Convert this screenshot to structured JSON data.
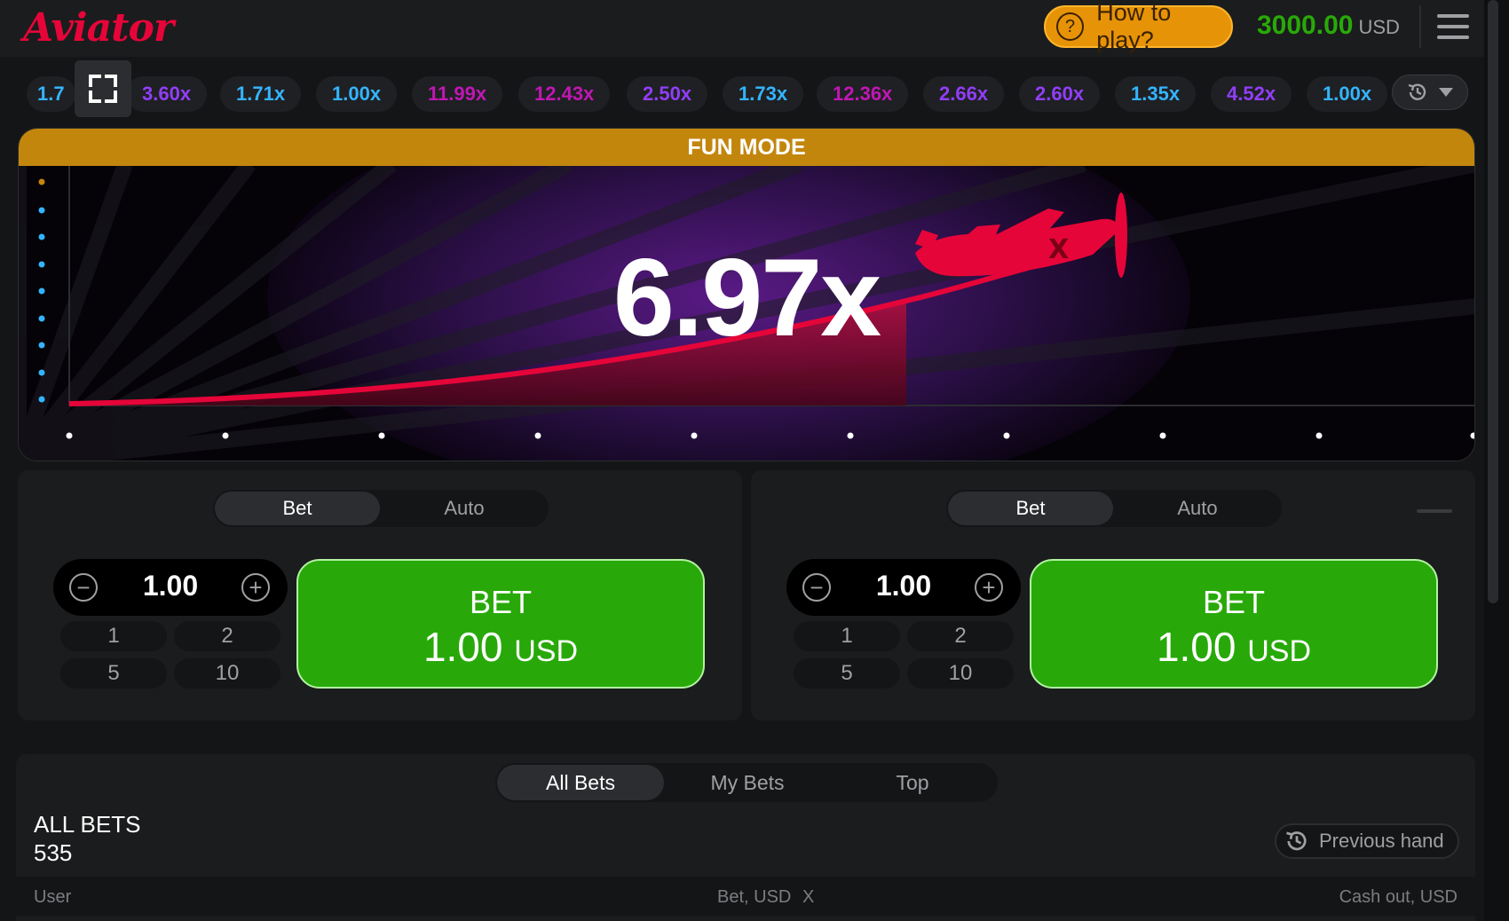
{
  "header": {
    "logo_text": "Aviator",
    "how_to_play": "How to play?",
    "help_glyph": "?",
    "balance": "3000.00",
    "currency": "USD",
    "menu_icon": "hamburger-icon"
  },
  "history": {
    "items": [
      {
        "value": "1.7",
        "color": "#34b4ff"
      },
      {
        "value": "3.60x",
        "color": "#913ef8"
      },
      {
        "value": "1.71x",
        "color": "#34b4ff"
      },
      {
        "value": "1.00x",
        "color": "#34b4ff"
      },
      {
        "value": "11.99x",
        "color": "#c017b4"
      },
      {
        "value": "12.43x",
        "color": "#c017b4"
      },
      {
        "value": "2.50x",
        "color": "#913ef8"
      },
      {
        "value": "1.73x",
        "color": "#34b4ff"
      },
      {
        "value": "12.36x",
        "color": "#c017b4"
      },
      {
        "value": "2.66x",
        "color": "#913ef8"
      },
      {
        "value": "2.60x",
        "color": "#913ef8"
      },
      {
        "value": "1.35x",
        "color": "#34b4ff"
      },
      {
        "value": "4.52x",
        "color": "#913ef8"
      },
      {
        "value": "1.00x",
        "color": "#34b4ff"
      }
    ],
    "fullscreen_icon": "fullscreen-icon",
    "history_icon": "history-clock-icon",
    "dropdown_icon": "chevron-down-icon"
  },
  "game": {
    "banner": "FUN MODE",
    "multiplier": "6.97x",
    "plane_icon": "red-plane-icon",
    "colors": {
      "curve": "#e50539",
      "banner": "#c3860d"
    }
  },
  "panels": [
    {
      "tab_bet": "Bet",
      "tab_auto": "Auto",
      "amount": "1.00",
      "quick": [
        "1",
        "2",
        "5",
        "10"
      ],
      "bet_label": "BET",
      "bet_amount": "1.00",
      "bet_currency": "USD"
    },
    {
      "tab_bet": "Bet",
      "tab_auto": "Auto",
      "amount": "1.00",
      "quick": [
        "1",
        "2",
        "5",
        "10"
      ],
      "bet_label": "BET",
      "bet_amount": "1.00",
      "bet_currency": "USD"
    }
  ],
  "bets": {
    "tabs": [
      "All Bets",
      "My Bets",
      "Top"
    ],
    "title": "ALL BETS",
    "count": "535",
    "previous_hand": "Previous hand",
    "columns": {
      "user": "User",
      "bet": "Bet, USD",
      "x": "X",
      "cashout": "Cash out, USD"
    }
  }
}
